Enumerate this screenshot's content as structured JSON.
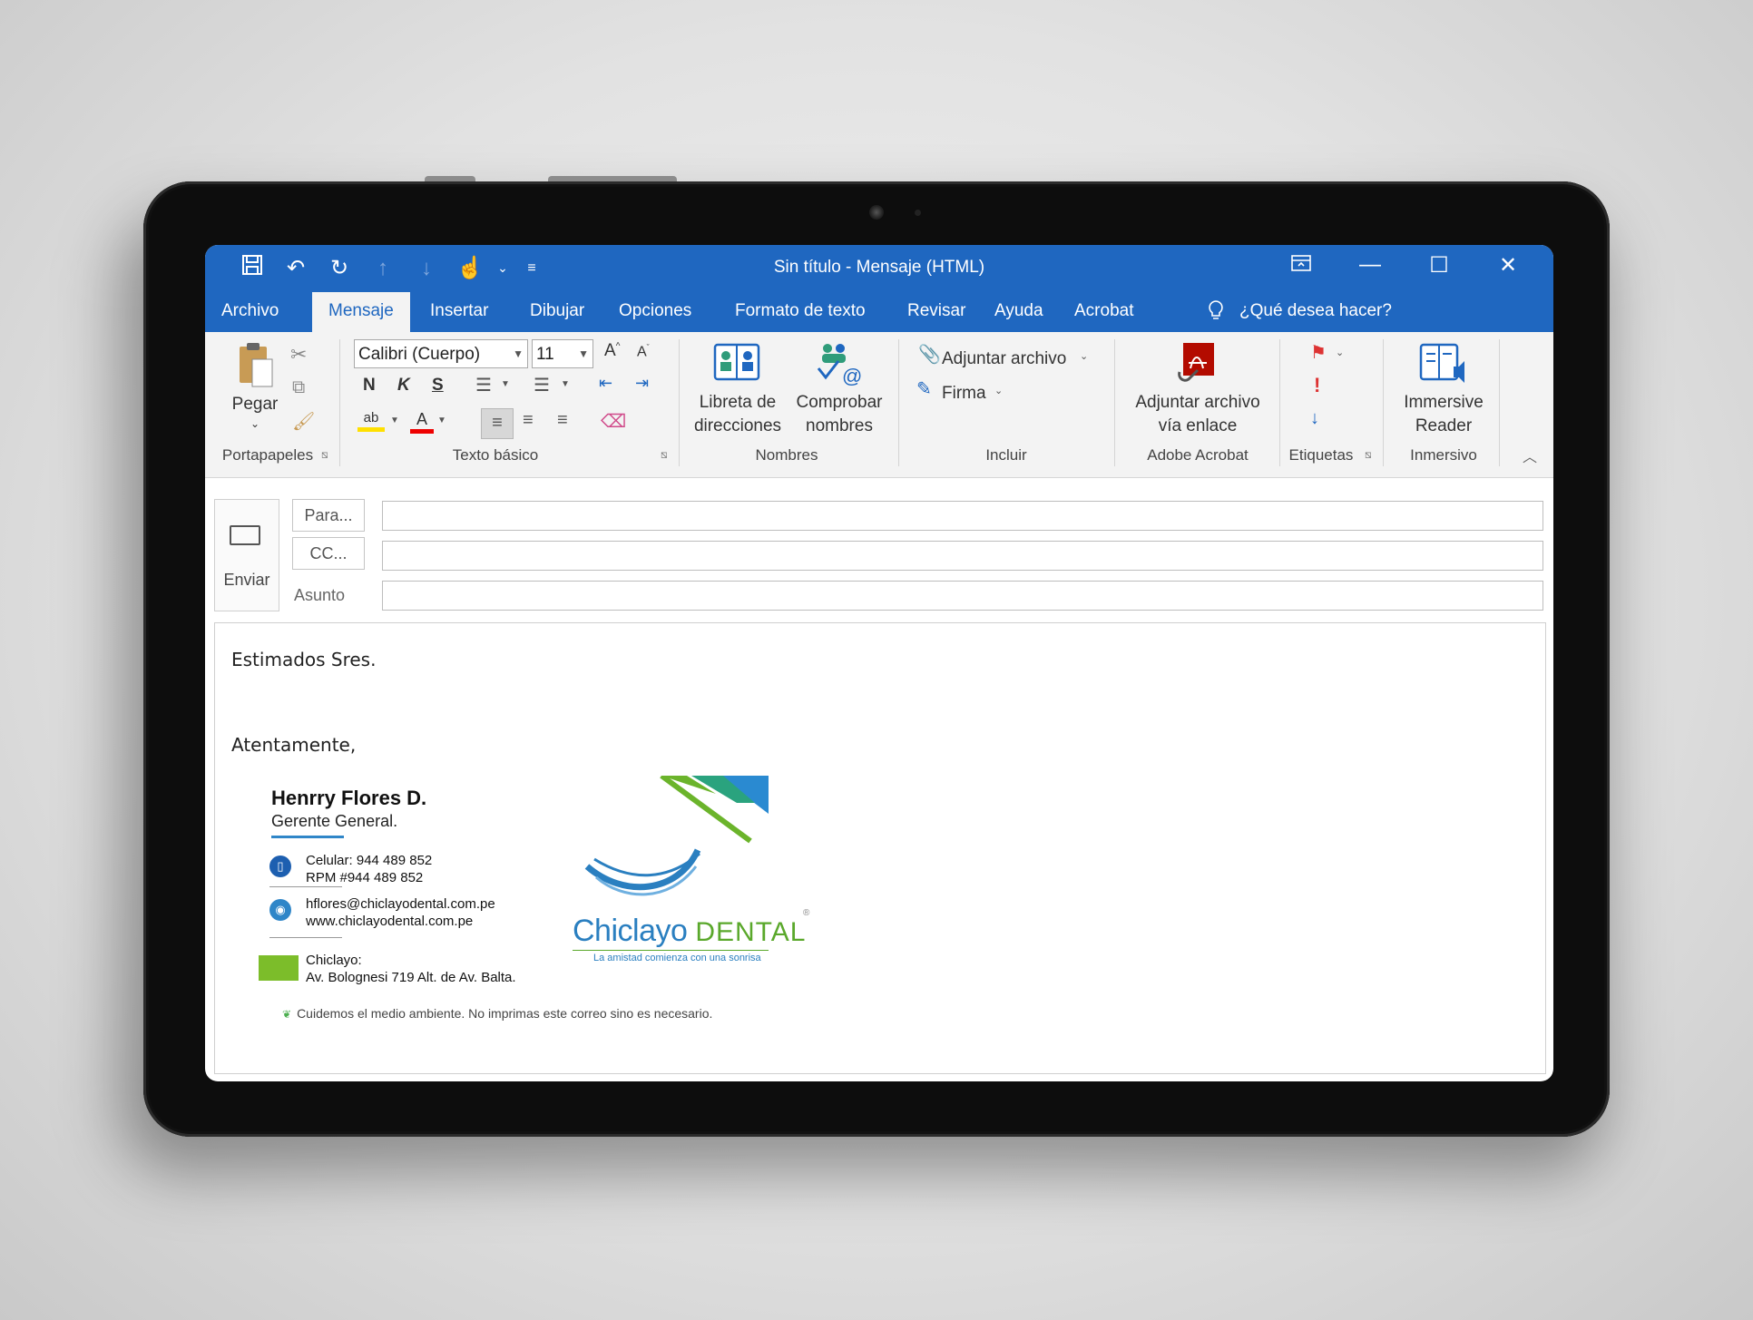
{
  "window": {
    "title": "Sin título  -  Mensaje (HTML)"
  },
  "quick_access": [
    "save-icon",
    "undo-icon",
    "redo-icon",
    "up-arrow-icon",
    "down-arrow-icon",
    "touch-mode-icon",
    "customize-icon"
  ],
  "tabs": [
    "Archivo",
    "Mensaje",
    "Insertar",
    "Dibujar",
    "Opciones",
    "Formato de texto",
    "Revisar",
    "Ayuda",
    "Acrobat"
  ],
  "tell_me": "¿Qué desea hacer?",
  "ribbon": {
    "clipboard": {
      "paste": "Pegar",
      "group": "Portapapeles"
    },
    "basic_text": {
      "font": "Calibri (Cuerpo)",
      "size": "11",
      "bold": "N",
      "italic": "K",
      "underline": "S",
      "group": "Texto básico"
    },
    "names": {
      "address_book_1": "Libreta de",
      "address_book_2": "direcciones",
      "check_names_1": "Comprobar",
      "check_names_2": "nombres",
      "group": "Nombres"
    },
    "include": {
      "attach_file": "Adjuntar archivo",
      "signature": "Firma",
      "group": "Incluir"
    },
    "acrobat": {
      "attach_link_1": "Adjuntar archivo",
      "attach_link_2": "vía enlace",
      "group": "Adobe Acrobat"
    },
    "tags": {
      "group": "Etiquetas"
    },
    "immersive": {
      "reader_1": "Immersive",
      "reader_2": "Reader",
      "group": "Inmersivo"
    }
  },
  "compose": {
    "send": "Enviar",
    "to": "Para...",
    "cc": "CC...",
    "subject_label": "Asunto",
    "to_value": "",
    "cc_value": "",
    "subject_value": ""
  },
  "body": {
    "greeting": "Estimados Sres.",
    "closing": "Atentamente,"
  },
  "signature": {
    "name": "Henrry Flores D.",
    "role": "Gerente General.",
    "phone": "Celular: 944 489 852\nRPM #944 489 852",
    "web": "hflores@chiclayodental.com.pe\nwww.chiclayodental.com.pe",
    "address": "Chiclayo:\nAv. Bolognesi 719 Alt. de Av. Balta.",
    "eco_note": "Cuidemos el medio ambiente. No imprimas este correo sino es necesario.",
    "logo_main": "Chiclayo",
    "logo_accent": "DENTAL",
    "logo_tagline": "La amistad comienza con una sonrisa"
  },
  "colors": {
    "titlebar": "#1f67c0",
    "brand_blue": "#2a7fc0",
    "brand_green": "#5aa82b"
  }
}
